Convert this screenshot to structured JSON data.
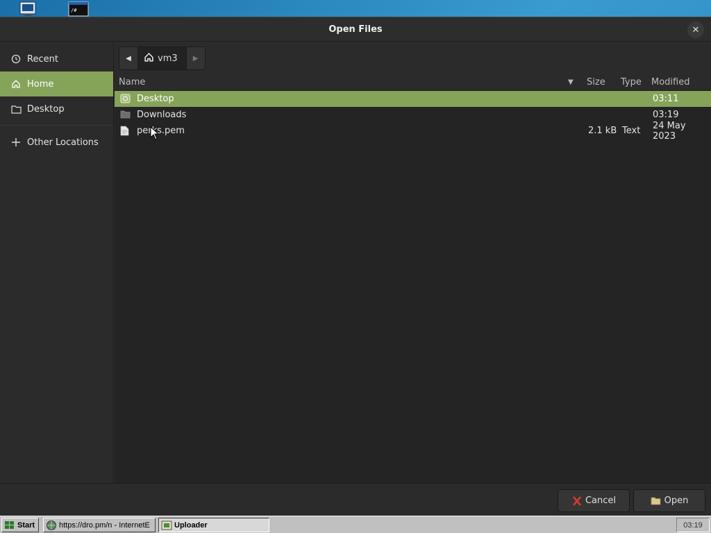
{
  "dialog": {
    "title": "Open Files",
    "close_icon": "close-icon"
  },
  "sidebar": {
    "items": [
      {
        "label": "Recent",
        "icon": "clock-icon"
      },
      {
        "label": "Home",
        "icon": "home-icon",
        "active": true
      },
      {
        "label": "Desktop",
        "icon": "folder-icon"
      },
      {
        "label": "Other Locations",
        "icon": "plus-icon"
      }
    ]
  },
  "pathbar": {
    "current": "vm3"
  },
  "columns": {
    "name": "Name",
    "size": "Size",
    "type": "Type",
    "modified": "Modified"
  },
  "files": [
    {
      "name": "Desktop",
      "size": "",
      "type": "",
      "modified": "03:11",
      "selected": true,
      "icon": "desktop-folder-icon"
    },
    {
      "name": "Downloads",
      "size": "",
      "type": "",
      "modified": "03:19",
      "selected": false,
      "icon": "folder-icon"
    },
    {
      "name": "perks.pem",
      "size": "2.1 kB",
      "type": "Text",
      "modified": "24 May 2023",
      "selected": false,
      "icon": "file-icon"
    }
  ],
  "buttons": {
    "cancel": "Cancel",
    "open": "Open"
  },
  "taskbar": {
    "start": "Start",
    "ie_task": "https://dro.pm/n - InternetE",
    "uploader_task": "Uploader",
    "clock": "03:19"
  },
  "colors": {
    "accent": "#86a35a",
    "dialog_bg": "#2b2b2b",
    "list_bg": "#242424"
  }
}
